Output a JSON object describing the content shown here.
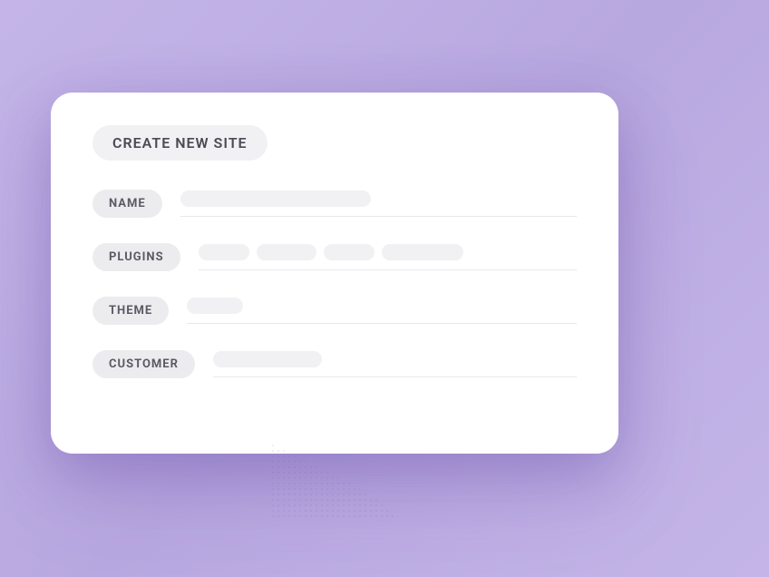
{
  "card": {
    "title": "CREATE NEW SITE",
    "fields": {
      "name": {
        "label": "NAME"
      },
      "plugins": {
        "label": "PLUGINS"
      },
      "theme": {
        "label": "THEME"
      },
      "customer": {
        "label": "CUSTOMER"
      }
    }
  }
}
